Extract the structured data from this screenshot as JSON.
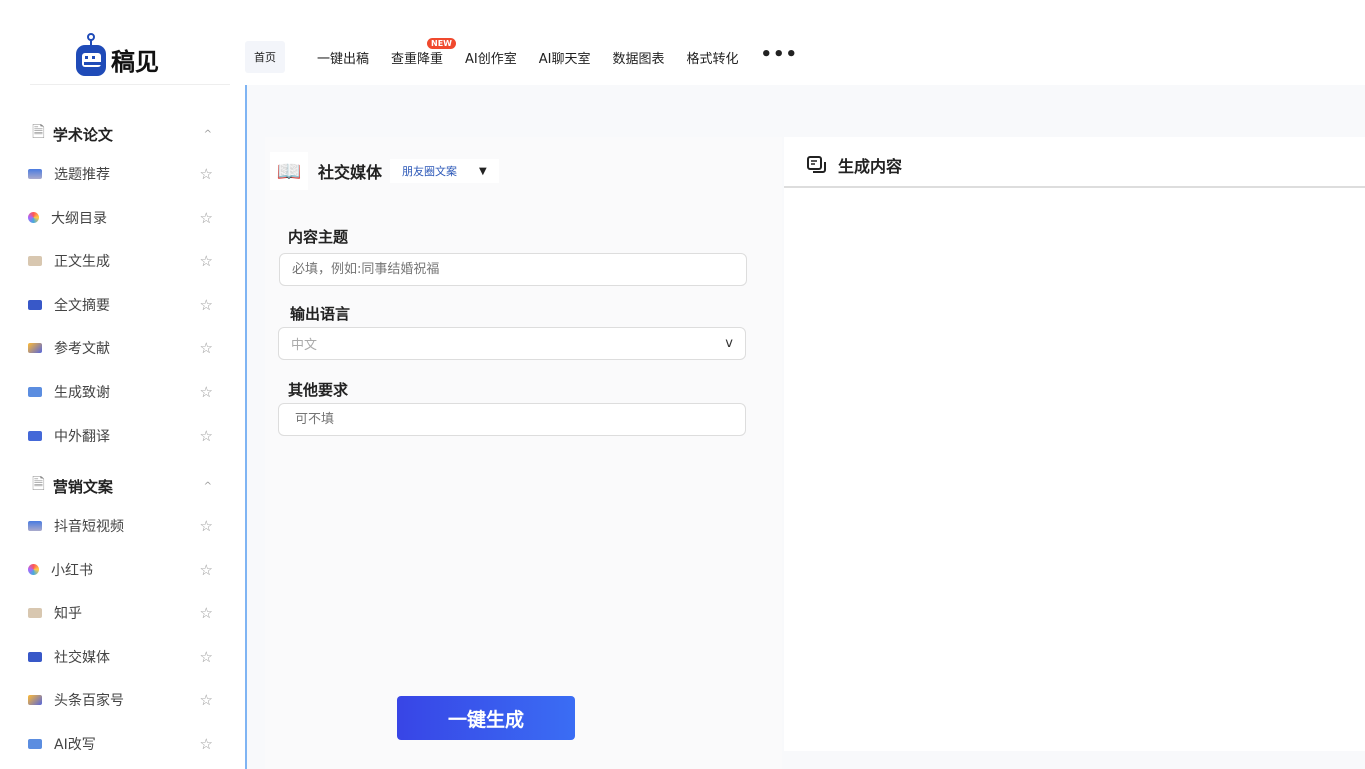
{
  "brand": {
    "name": "稿见",
    "accent": "#1f4bb8"
  },
  "nav": {
    "items": [
      "首页",
      "一键出稿",
      "查重降重",
      "AI创作室",
      "AI聊天室",
      "数据图表",
      "格式转化"
    ],
    "badge": "NEW",
    "more": "•••"
  },
  "sidebar": {
    "sections": [
      {
        "title": "学术论文",
        "items": [
          "选题推荐",
          "大纲目录",
          "正文生成",
          "全文摘要",
          "参考文献",
          "生成致谢",
          "中外翻译"
        ]
      },
      {
        "title": "营销文案",
        "items": [
          "抖音短视频",
          "小红书",
          "知乎",
          "社交媒体",
          "头条百家号",
          "AI改写"
        ]
      }
    ]
  },
  "form": {
    "title": "社交媒体",
    "type": "朋友圈文案",
    "topic_label": "内容主题",
    "topic_placeholder": "必填，例如:同事结婚祝福",
    "lang_label": "输出语言",
    "lang_value": "中文",
    "other_label": "其他要求",
    "other_placeholder": "可不填",
    "submit": "一键生成"
  },
  "output": {
    "title": "生成内容"
  }
}
